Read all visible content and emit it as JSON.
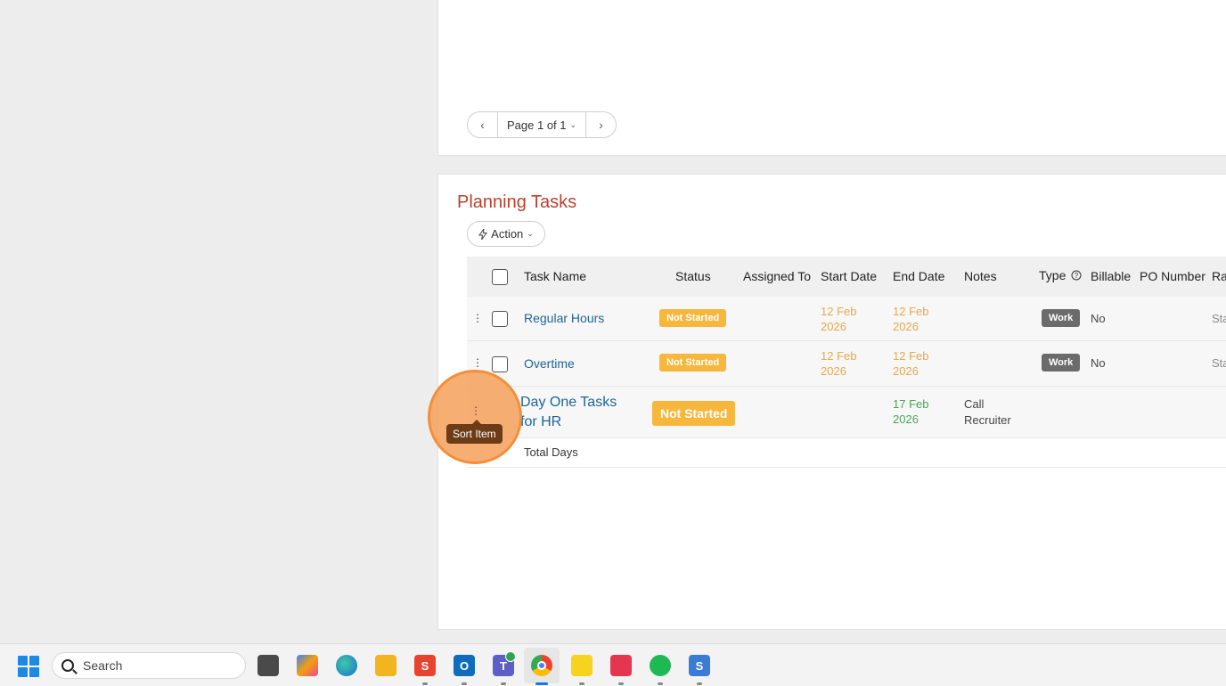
{
  "pager": {
    "prev_glyph": "‹",
    "label": "Page 1 of 1",
    "next_glyph": "›"
  },
  "section": {
    "title": "Planning Tasks",
    "action_label": "Action"
  },
  "table": {
    "headers": {
      "task_name": "Task Name",
      "status": "Status",
      "assigned_to": "Assigned To",
      "start_date": "Start Date",
      "end_date": "End Date",
      "notes": "Notes",
      "type": "Type",
      "billable": "Billable",
      "po_number": "PO Number",
      "rate_clipped": "Ra"
    },
    "rows": [
      {
        "task_name": "Regular Hours",
        "status": "Not Started",
        "start_date_1": "12 Feb",
        "start_date_2": "2026",
        "end_date_1": "12 Feb",
        "end_date_2": "2026",
        "type": "Work",
        "billable": "No",
        "rate_clipped": "Sta"
      },
      {
        "task_name": "Overtime",
        "status": "Not Started",
        "start_date_1": "12 Feb",
        "start_date_2": "2026",
        "end_date_1": "12 Feb",
        "end_date_2": "2026",
        "type": "Work",
        "billable": "No",
        "rate_clipped": "Sta"
      },
      {
        "task_name_1": "Day One Tasks",
        "task_name_2": "for HR",
        "status": "Not Started",
        "end_date_1": "17 Feb",
        "end_date_2": "2026",
        "notes_1": "Call",
        "notes_2": "Recruiter"
      }
    ],
    "total_label": "Total Days"
  },
  "tooltip": "Sort Item",
  "taskbar": {
    "search_placeholder": "Search"
  },
  "colors": {
    "title": "#b8412f",
    "link": "#1f6496",
    "status_badge": "#f6b73c",
    "type_badge": "#6b6b6b",
    "date_orange": "#e8a84e",
    "date_green": "#4aa657",
    "highlight": "#f2903a"
  }
}
